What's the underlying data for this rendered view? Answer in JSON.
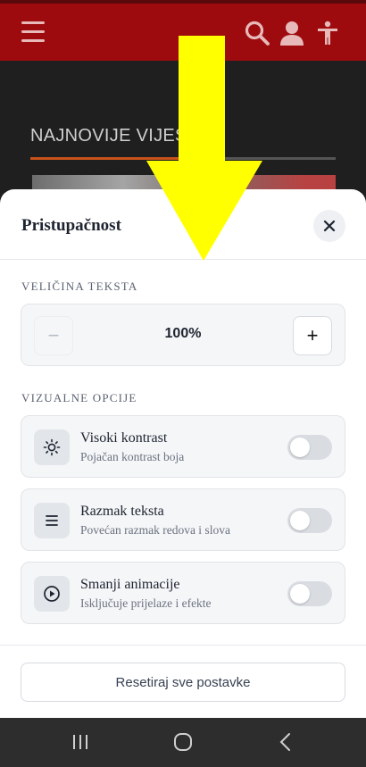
{
  "header": {
    "menu_icon": "hamburger-menu-icon",
    "search_icon": "search-icon",
    "user_icon": "user-icon",
    "accessibility_icon": "accessibility-icon",
    "colors": {
      "bar": "#9e0b0f",
      "icons": "#e7b9b9"
    }
  },
  "page": {
    "section_title": "NAJNOVIJE VIJESTI",
    "accent_color": "#c8531a"
  },
  "sheet": {
    "title": "Pristupačnost",
    "close_icon": "close-icon",
    "text_size": {
      "label": "VELIČINA TEKSTA",
      "minus": "−",
      "plus": "+",
      "value": "100%"
    },
    "visual": {
      "label": "VIZUALNE OPCIJE",
      "options": [
        {
          "title": "Visoki kontrast",
          "subtitle": "Pojačan kontrast boja",
          "icon": "sun-icon",
          "enabled": false
        },
        {
          "title": "Razmak teksta",
          "subtitle": "Povećan razmak redova i slova",
          "icon": "lines-icon",
          "enabled": false
        },
        {
          "title": "Smanji animacije",
          "subtitle": "Isključuje prijelaze i efekte",
          "icon": "play-circle-icon",
          "enabled": false
        }
      ]
    },
    "reset_label": "Resetiraj sve postavke"
  },
  "annotation": {
    "arrow_color": "#ffff00",
    "arrow_icon": "down-arrow-icon"
  },
  "navbar": {
    "recent_icon": "recent-apps-icon",
    "home_icon": "home-icon",
    "back_icon": "back-icon"
  }
}
